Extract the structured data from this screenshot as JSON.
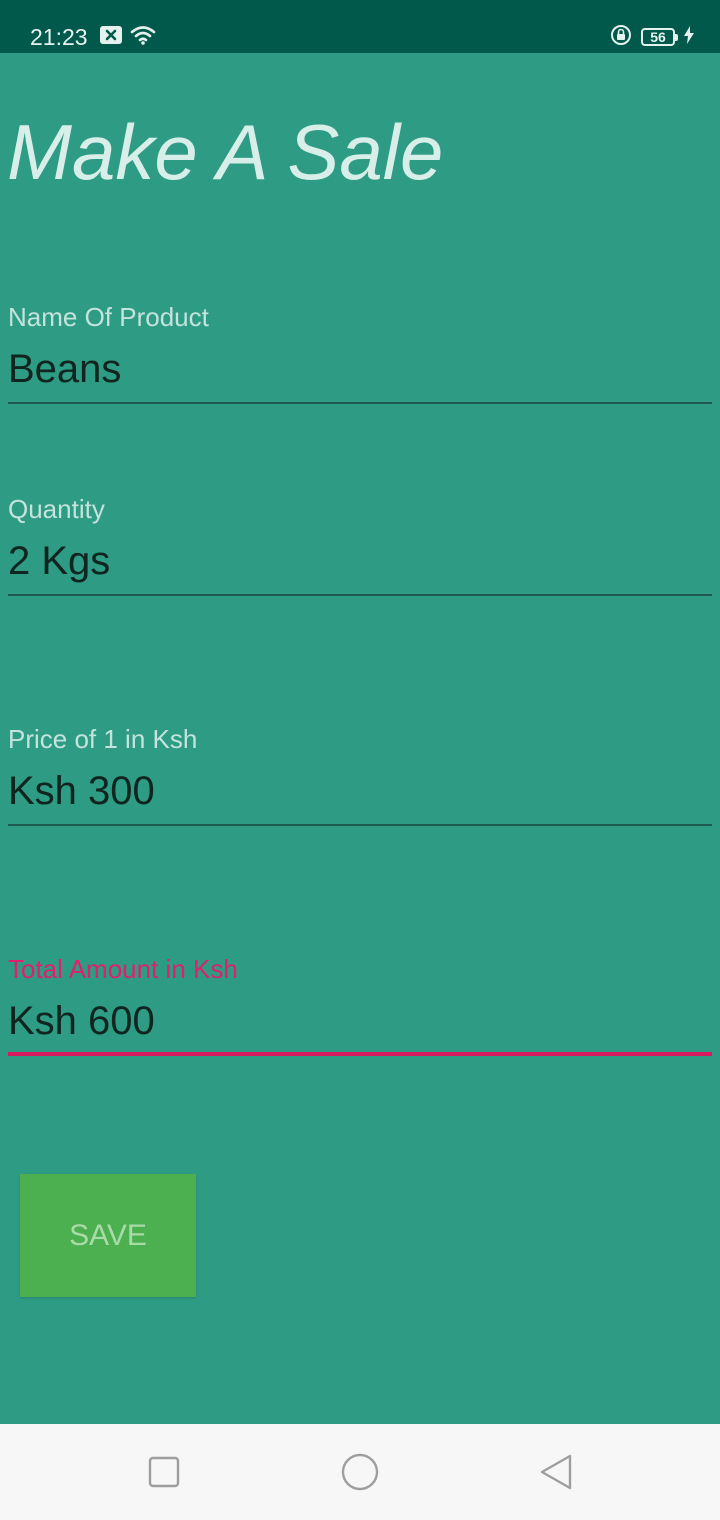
{
  "status_bar": {
    "time": "21:23",
    "battery_level": "56",
    "icons": [
      "notification-x-icon",
      "wifi-icon",
      "rotation-lock-icon",
      "battery-icon",
      "charging-bolt-icon"
    ]
  },
  "page": {
    "title": "Make A Sale"
  },
  "form": {
    "product": {
      "label": "Name Of Product",
      "value": "Beans"
    },
    "quantity": {
      "label": "Quantity",
      "value": "2 Kgs"
    },
    "price": {
      "label": "Price of 1 in Ksh",
      "value": "Ksh 300"
    },
    "total": {
      "label": "Total Amount in Ksh",
      "value": "Ksh 600"
    }
  },
  "actions": {
    "save_label": "SAVE"
  },
  "nav_bar": {
    "icons": [
      "recents-square-icon",
      "home-circle-icon",
      "back-triangle-icon"
    ]
  },
  "colors": {
    "background": "#2e9b84",
    "status_bar": "#00594a",
    "accent": "#d81b60",
    "save_button": "#4caf50",
    "nav_bar": "#f7f7f7"
  }
}
